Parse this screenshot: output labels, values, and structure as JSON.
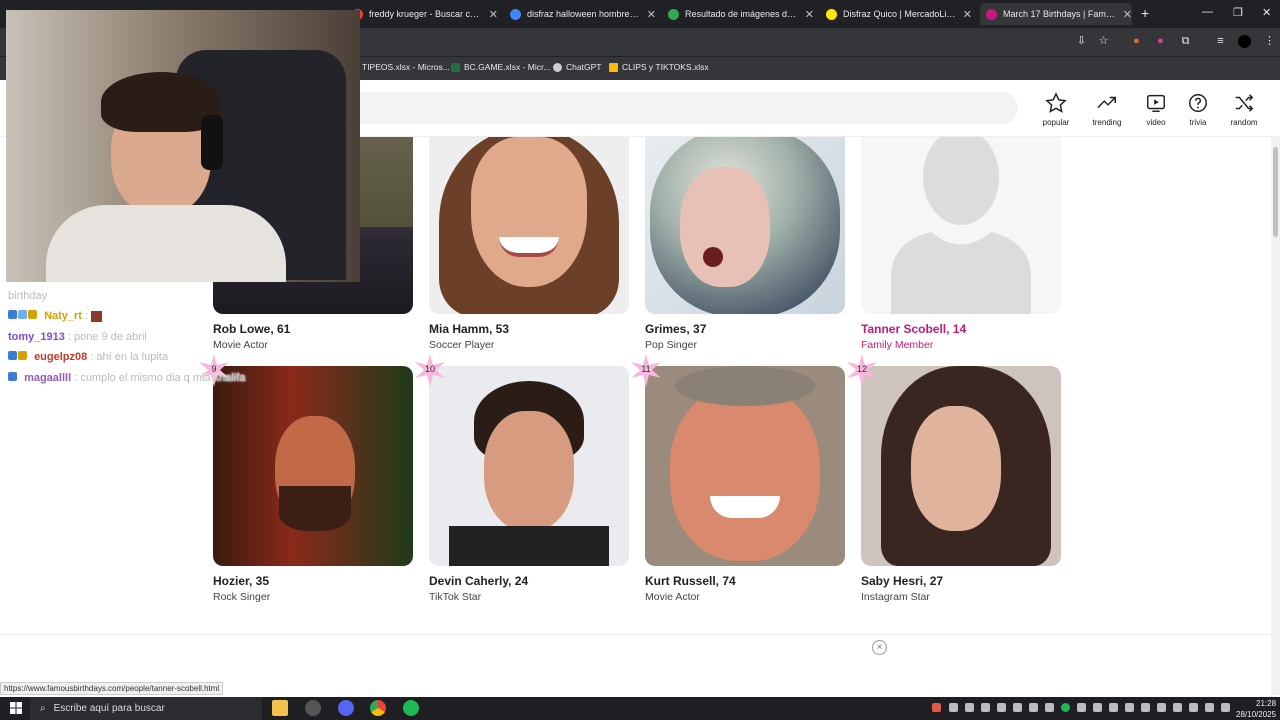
{
  "browser": {
    "tabs": [
      {
        "title": "freddy krueger - Buscar con Go",
        "active": false
      },
      {
        "title": "disfraz halloween hombre - Bu",
        "active": false
      },
      {
        "title": "Resultado de imágenes de Goo",
        "active": false
      },
      {
        "title": "Disfraz Quico | MercadoLibre",
        "active": false
      },
      {
        "title": "March 17 Birthdays | Famous Bi",
        "active": true
      }
    ],
    "bookmarks": [
      "TIPEOS.xlsx - Micros...",
      "BC.GAME.xlsx - Micr...",
      "ChatGPT",
      "CLIPS y TIKTOKS.xlsx"
    ]
  },
  "site": {
    "nav": [
      {
        "label": "popular",
        "icon": "star-icon"
      },
      {
        "label": "trending",
        "icon": "trending-icon"
      },
      {
        "label": "video",
        "icon": "video-icon"
      },
      {
        "label": "trivia",
        "icon": "question-icon"
      },
      {
        "label": "random",
        "icon": "shuffle-icon"
      }
    ],
    "row1": [
      {
        "name": "Rob Lowe, 61",
        "role": "Movie Actor"
      },
      {
        "name": "Mia Hamm, 53",
        "role": "Soccer Player"
      },
      {
        "name": "Grimes, 37",
        "role": "Pop Singer"
      },
      {
        "name": "Tanner Scobell, 14",
        "role": "Family Member"
      }
    ],
    "row2": [
      {
        "rank": "9",
        "name": "Hozier, 35",
        "role": "Rock Singer"
      },
      {
        "rank": "10",
        "name": "Devin Caherly, 24",
        "role": "TikTok Star"
      },
      {
        "rank": "11",
        "name": "Kurt Russell, 74",
        "role": "Movie Actor"
      },
      {
        "rank": "12",
        "name": "Saby Hesri, 27",
        "role": "Instagram Star"
      }
    ],
    "ad_close": "×",
    "status_url": "https://www.famousbirthdays.com/people/tanner-scobell.html"
  },
  "chat": [
    {
      "user": "",
      "msg": "birthday",
      "color": "#888888"
    },
    {
      "user": "Naty_rt",
      "msg": ":",
      "color": "#d4a200"
    },
    {
      "user": "tomy_1913",
      "msg": ": pone 9 de abril",
      "color": "#7b4fd6"
    },
    {
      "user": "eugelpz08",
      "msg": ": ahí en la lupita",
      "color": "#c0392b"
    },
    {
      "user": "magaallll",
      "msg": ": cumplo el mismo dia q mia khalifa",
      "color": "#9b59b6"
    }
  ],
  "taskbar": {
    "search_placeholder": "Escribe aquí para buscar",
    "time": "21:28",
    "date": "28/10/2025"
  },
  "colors": {
    "accent_pink": "#c21b7a",
    "rank_star": "#f7b8df"
  }
}
